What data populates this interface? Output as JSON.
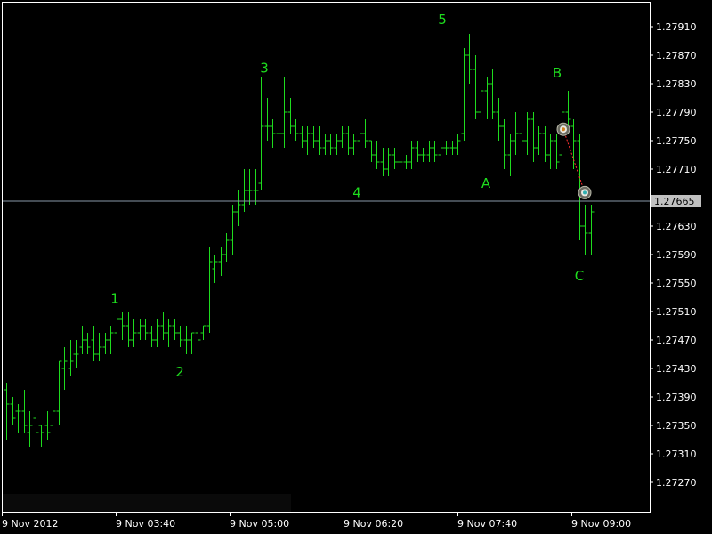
{
  "chart_data": {
    "type": "bar",
    "subtype": "ohlc",
    "title": "",
    "xlabel": "",
    "ylabel": "",
    "ylim": [
      1.2724,
      1.2796
    ],
    "y_ticks": [
      "1.27910",
      "1.27870",
      "1.27830",
      "1.27790",
      "1.27750",
      "1.27710",
      "1.27665",
      "1.27630",
      "1.27590",
      "1.27550",
      "1.27510",
      "1.27470",
      "1.27430",
      "1.27390",
      "1.27350",
      "1.27310",
      "1.27270"
    ],
    "x_ticks": [
      "9 Nov 2012",
      "9 Nov 03:40",
      "9 Nov 05:00",
      "9 Nov 06:20",
      "9 Nov 07:40",
      "9 Nov 09:00"
    ],
    "grid": false,
    "current_price": "1.27665",
    "colors": {
      "background": "#000000",
      "bars": "#1edc1e",
      "labels": "#1edc1e",
      "axis": "#ffffff",
      "price_line": "#8898a8",
      "price_tag": "#c0c0c0",
      "signal_line": "#ff3030"
    },
    "wave_labels": [
      {
        "text": "1",
        "x": "9 Nov 03:40",
        "y": 1.27528
      },
      {
        "text": "2",
        "x": "9 Nov 03:40",
        "y": 1.27425
      },
      {
        "text": "3",
        "x": "9 Nov 05:00",
        "y": 1.27852
      },
      {
        "text": "4",
        "x": "9 Nov 06:20",
        "y": 1.27677
      },
      {
        "text": "5",
        "x": "9 Nov 07:40",
        "y": 1.2792
      },
      {
        "text": "A",
        "x": "9 Nov 07:40",
        "y": 1.2769
      },
      {
        "text": "B",
        "x": "9 Nov 09:00",
        "y": 1.27845
      },
      {
        "text": "C",
        "x": "9 Nov 09:00",
        "y": 1.2756
      }
    ],
    "signal_markers": [
      {
        "name": "signal-marker-top",
        "y": 1.27766
      },
      {
        "name": "signal-marker-bottom",
        "y": 1.27677
      }
    ],
    "series": [
      {
        "values": [
          [
            1.274,
            1.2741,
            1.2733,
            1.2738
          ],
          [
            1.2738,
            1.2739,
            1.2735,
            1.2736
          ],
          [
            1.2737,
            1.2738,
            1.2734,
            1.2737
          ],
          [
            1.2737,
            1.274,
            1.2734,
            1.2735
          ],
          [
            1.2734,
            1.2737,
            1.2732,
            1.2735
          ],
          [
            1.2736,
            1.2737,
            1.2733,
            1.2734
          ],
          [
            1.2735,
            1.2735,
            1.2732,
            1.2734
          ],
          [
            1.2735,
            1.2737,
            1.2733,
            1.2734
          ],
          [
            1.2735,
            1.2738,
            1.2734,
            1.2737
          ],
          [
            1.2737,
            1.2744,
            1.2735,
            1.2744
          ],
          [
            1.2743,
            1.2746,
            1.274,
            1.2744
          ],
          [
            1.2743,
            1.2747,
            1.2742,
            1.2744
          ],
          [
            1.2745,
            1.2747,
            1.2743,
            1.2745
          ],
          [
            1.2746,
            1.2749,
            1.2745,
            1.2747
          ],
          [
            1.2747,
            1.2748,
            1.2745,
            1.2746
          ],
          [
            1.2747,
            1.2749,
            1.2744,
            1.2745
          ],
          [
            1.2745,
            1.2748,
            1.2744,
            1.2746
          ],
          [
            1.2746,
            1.2748,
            1.2745,
            1.2747
          ],
          [
            1.2747,
            1.2749,
            1.2745,
            1.2748
          ],
          [
            1.2748,
            1.2751,
            1.2747,
            1.275
          ],
          [
            1.275,
            1.2751,
            1.2747,
            1.2749
          ],
          [
            1.2749,
            1.2751,
            1.2746,
            1.2747
          ],
          [
            1.2747,
            1.275,
            1.2746,
            1.2748
          ],
          [
            1.2748,
            1.275,
            1.2747,
            1.2749
          ],
          [
            1.2749,
            1.275,
            1.2747,
            1.2748
          ],
          [
            1.2748,
            1.2749,
            1.2746,
            1.2747
          ],
          [
            1.2747,
            1.275,
            1.2746,
            1.2749
          ],
          [
            1.2749,
            1.2751,
            1.2747,
            1.2748
          ],
          [
            1.2748,
            1.275,
            1.2746,
            1.2749
          ],
          [
            1.2749,
            1.275,
            1.2747,
            1.2748
          ],
          [
            1.2748,
            1.2749,
            1.2746,
            1.2747
          ],
          [
            1.2747,
            1.2749,
            1.2745,
            1.2747
          ],
          [
            1.2747,
            1.2748,
            1.2745,
            1.2748
          ],
          [
            1.2748,
            1.2748,
            1.2746,
            1.2747
          ],
          [
            1.2748,
            1.2749,
            1.2747,
            1.2749
          ],
          [
            1.2749,
            1.276,
            1.2748,
            1.2758
          ],
          [
            1.2757,
            1.2759,
            1.2755,
            1.2758
          ],
          [
            1.2758,
            1.276,
            1.2756,
            1.2759
          ],
          [
            1.2759,
            1.2762,
            1.2758,
            1.2761
          ],
          [
            1.2761,
            1.2766,
            1.2759,
            1.2765
          ],
          [
            1.2765,
            1.2768,
            1.2763,
            1.2766
          ],
          [
            1.2766,
            1.2771,
            1.2765,
            1.2768
          ],
          [
            1.2768,
            1.2771,
            1.2766,
            1.2768
          ],
          [
            1.2768,
            1.2771,
            1.2766,
            1.2768
          ],
          [
            1.2769,
            1.2784,
            1.2768,
            1.2777
          ],
          [
            1.2777,
            1.2781,
            1.2775,
            1.2777
          ],
          [
            1.2777,
            1.2778,
            1.2774,
            1.2776
          ],
          [
            1.2776,
            1.2778,
            1.2774,
            1.2776
          ],
          [
            1.2776,
            1.2784,
            1.2774,
            1.2779
          ],
          [
            1.2779,
            1.2781,
            1.2776,
            1.2777
          ],
          [
            1.2777,
            1.2778,
            1.2775,
            1.2776
          ],
          [
            1.2776,
            1.2777,
            1.2774,
            1.2775
          ],
          [
            1.2775,
            1.2777,
            1.2773,
            1.2776
          ],
          [
            1.2776,
            1.2777,
            1.2774,
            1.2775
          ],
          [
            1.2775,
            1.2777,
            1.2773,
            1.2774
          ],
          [
            1.2774,
            1.2776,
            1.2773,
            1.2775
          ],
          [
            1.2775,
            1.2776,
            1.2773,
            1.2774
          ],
          [
            1.2774,
            1.2776,
            1.2773,
            1.2775
          ],
          [
            1.2775,
            1.2777,
            1.2774,
            1.2776
          ],
          [
            1.2776,
            1.2777,
            1.2773,
            1.2774
          ],
          [
            1.2774,
            1.2776,
            1.2773,
            1.2775
          ],
          [
            1.2775,
            1.2777,
            1.2774,
            1.2776
          ],
          [
            1.2776,
            1.2778,
            1.2774,
            1.2775
          ],
          [
            1.2775,
            1.2775,
            1.2772,
            1.2773
          ],
          [
            1.2773,
            1.2775,
            1.2771,
            1.2772
          ],
          [
            1.2772,
            1.2774,
            1.277,
            1.2771
          ],
          [
            1.2771,
            1.2774,
            1.277,
            1.2773
          ],
          [
            1.2773,
            1.2774,
            1.2771,
            1.2772
          ],
          [
            1.2772,
            1.2773,
            1.2771,
            1.2772
          ],
          [
            1.2772,
            1.2773,
            1.2771,
            1.2772
          ],
          [
            1.2772,
            1.2775,
            1.2771,
            1.2774
          ],
          [
            1.2774,
            1.2775,
            1.2772,
            1.2773
          ],
          [
            1.2773,
            1.2774,
            1.2772,
            1.2773
          ],
          [
            1.2773,
            1.2775,
            1.2772,
            1.2774
          ],
          [
            1.2774,
            1.2775,
            1.2772,
            1.2773
          ],
          [
            1.2773,
            1.2774,
            1.2772,
            1.2774
          ],
          [
            1.2774,
            1.2775,
            1.2773,
            1.2774
          ],
          [
            1.2774,
            1.2775,
            1.2773,
            1.2774
          ],
          [
            1.2774,
            1.2776,
            1.2773,
            1.2775
          ],
          [
            1.2776,
            1.2788,
            1.2775,
            1.2787
          ],
          [
            1.2787,
            1.279,
            1.2783,
            1.2785
          ],
          [
            1.2785,
            1.2787,
            1.2778,
            1.2779
          ],
          [
            1.2779,
            1.2786,
            1.2777,
            1.2782
          ],
          [
            1.2782,
            1.2784,
            1.2778,
            1.2783
          ],
          [
            1.2783,
            1.2785,
            1.2778,
            1.2779
          ],
          [
            1.2779,
            1.2781,
            1.2775,
            1.2777
          ],
          [
            1.2777,
            1.2778,
            1.2771,
            1.2773
          ],
          [
            1.2773,
            1.2776,
            1.277,
            1.2775
          ],
          [
            1.2775,
            1.2779,
            1.2773,
            1.2776
          ],
          [
            1.2776,
            1.2778,
            1.2774,
            1.2775
          ],
          [
            1.2775,
            1.2779,
            1.2773,
            1.2778
          ],
          [
            1.2778,
            1.2779,
            1.2772,
            1.2774
          ],
          [
            1.2774,
            1.2777,
            1.2773,
            1.2776
          ],
          [
            1.2776,
            1.2777,
            1.2772,
            1.2773
          ],
          [
            1.2773,
            1.2776,
            1.2771,
            1.2775
          ],
          [
            1.2775,
            1.2776,
            1.2771,
            1.2772
          ],
          [
            1.2773,
            1.278,
            1.2772,
            1.2779
          ],
          [
            1.2779,
            1.2782,
            1.2776,
            1.2778
          ],
          [
            1.2777,
            1.2778,
            1.2771,
            1.2775
          ],
          [
            1.2775,
            1.2776,
            1.2761,
            1.2763
          ],
          [
            1.2763,
            1.2766,
            1.2759,
            1.2762
          ],
          [
            1.2762,
            1.2766,
            1.2759,
            1.2765
          ]
        ]
      }
    ]
  }
}
